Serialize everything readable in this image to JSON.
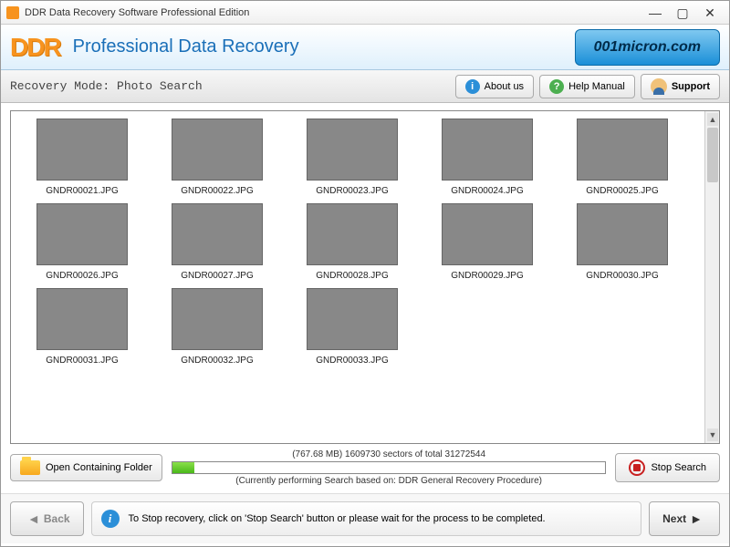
{
  "window": {
    "title": "DDR Data Recovery Software Professional Edition"
  },
  "header": {
    "logo": "DDR",
    "title": "Professional Data Recovery",
    "brand": "001micron.com"
  },
  "toolbar": {
    "mode_label": "Recovery Mode: Photo Search",
    "about": "About us",
    "help": "Help Manual",
    "support": "Support"
  },
  "thumbs": [
    {
      "name": "GNDR00021.JPG"
    },
    {
      "name": "GNDR00022.JPG"
    },
    {
      "name": "GNDR00023.JPG"
    },
    {
      "name": "GNDR00024.JPG"
    },
    {
      "name": "GNDR00025.JPG"
    },
    {
      "name": "GNDR00026.JPG"
    },
    {
      "name": "GNDR00027.JPG"
    },
    {
      "name": "GNDR00028.JPG"
    },
    {
      "name": "GNDR00029.JPG"
    },
    {
      "name": "GNDR00030.JPG"
    },
    {
      "name": "GNDR00031.JPG"
    },
    {
      "name": "GNDR00032.JPG"
    },
    {
      "name": "GNDR00033.JPG"
    }
  ],
  "progress": {
    "open_folder": "Open Containing Folder",
    "status": "(767.68 MB) 1609730  sectors  of  total 31272544",
    "substatus": "(Currently performing Search based on:  DDR General Recovery Procedure)",
    "stop": "Stop Search",
    "percent": 5.1
  },
  "footer": {
    "back": "Back",
    "next": "Next",
    "info": "To Stop recovery, click on 'Stop Search' button or please wait for the process to be completed."
  }
}
